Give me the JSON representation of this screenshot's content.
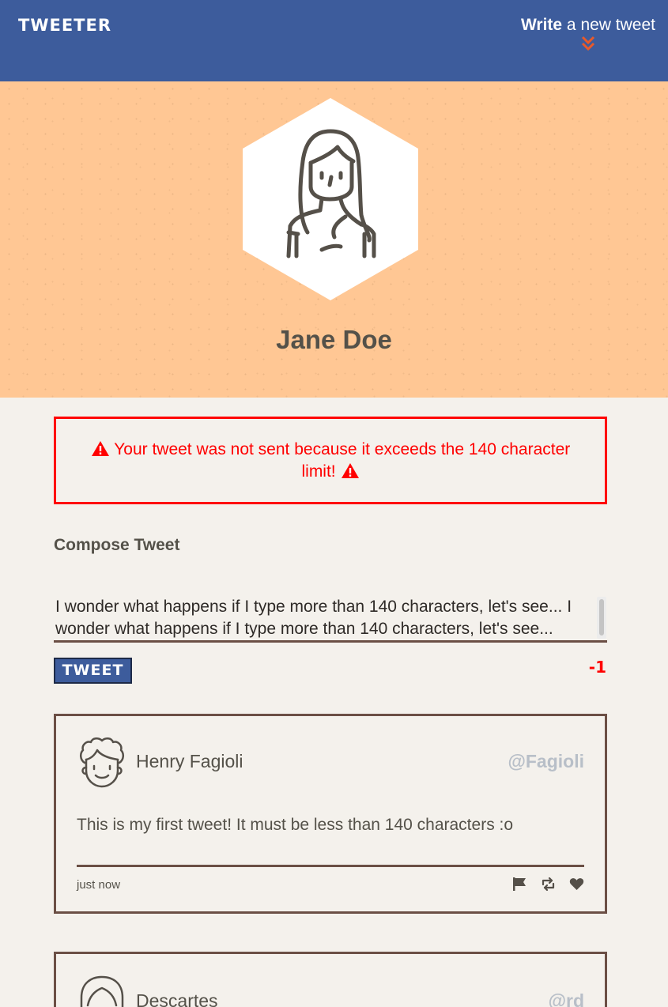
{
  "nav": {
    "logo": "TWEETER",
    "compose_strong": "Write",
    "compose_rest": " a new tweet",
    "chevron_icon": "double-chevron-down-icon"
  },
  "profile": {
    "name": "Jane Doe",
    "avatar_icon": "girl-avatar-icon"
  },
  "error": {
    "message": "Your tweet was not sent because it exceeds the 140 character limit!",
    "color": "#ff0000",
    "icon": "warning-icon"
  },
  "compose": {
    "title": "Compose Tweet",
    "text": "I wonder what happens if I type more than 140 characters, let's see... I wonder what happens if I type more than 140 characters, let's see...",
    "button_label": "TWEET",
    "counter": "-1"
  },
  "tweets": [
    {
      "name": "Henry Fagioli",
      "handle": "@Fagioli",
      "body": "This is my first tweet! It must be less than 140 characters :o",
      "time": "just now",
      "avatar_icon": "curly-hair-man-avatar-icon"
    },
    {
      "name": "Descartes",
      "handle": "@rd",
      "avatar_icon": "long-hair-man-avatar-icon"
    }
  ],
  "colors": {
    "nav": "#3d5c9c",
    "header": "#ffc794",
    "background": "#f4f1ec",
    "border": "#6b4f45",
    "handle": "#b8bfc8"
  }
}
